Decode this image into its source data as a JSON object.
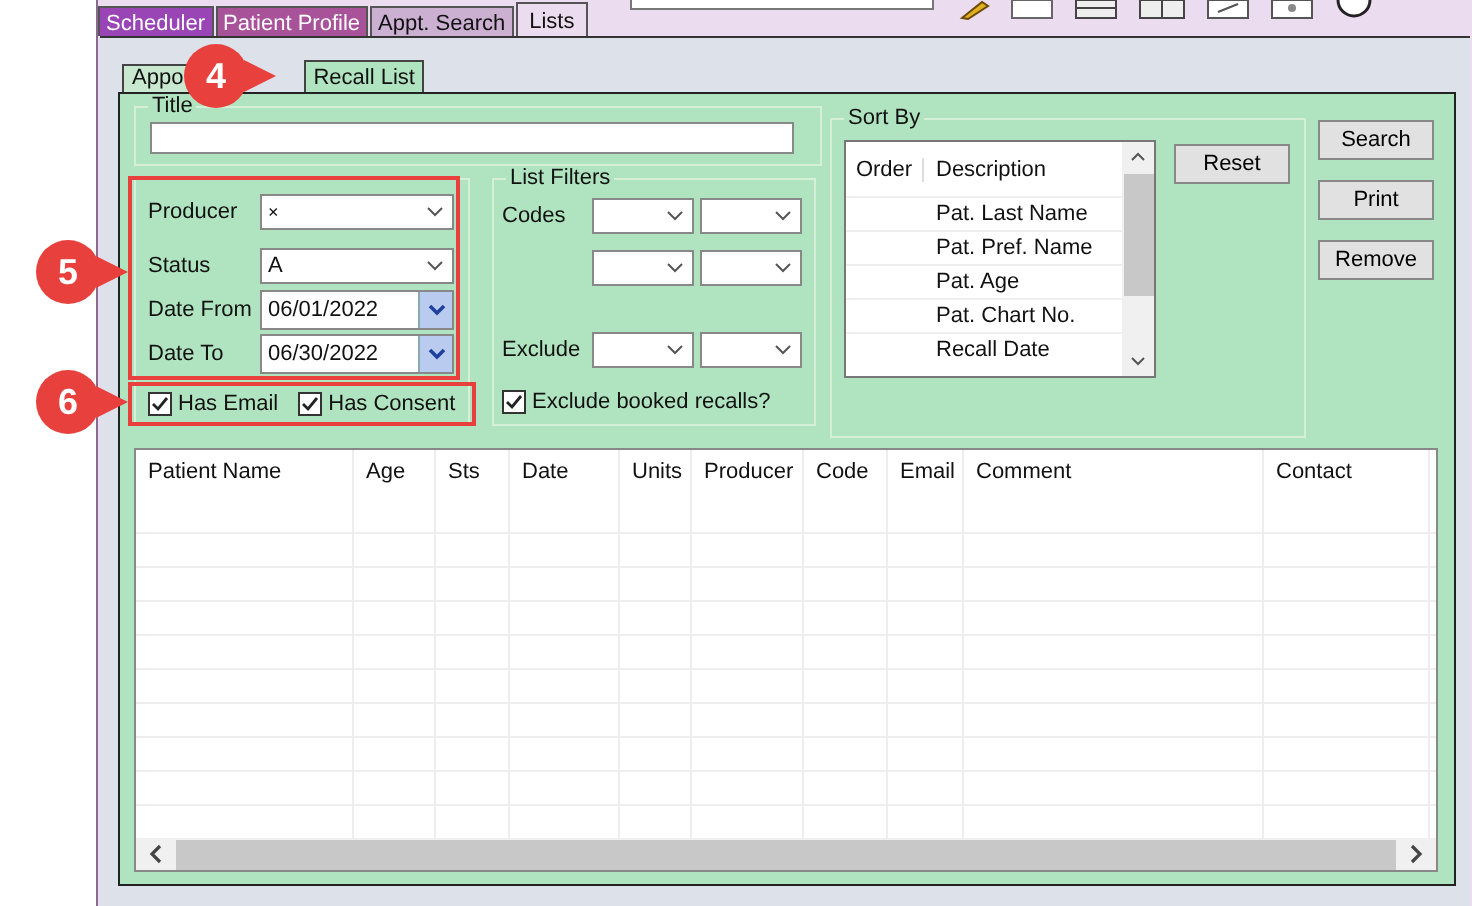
{
  "top_tabs": [
    {
      "label": "Scheduler",
      "selected": false,
      "color": "#9a45b6"
    },
    {
      "label": "Patient Profile",
      "selected": false,
      "color": "#a8529a"
    },
    {
      "label": "Appt. Search",
      "selected": false,
      "color": "#cbb0d2"
    },
    {
      "label": "Lists",
      "selected": true,
      "color": "#ecdcef"
    }
  ],
  "sub_tabs": [
    {
      "label": "Appo",
      "selected": false
    },
    {
      "label": "Recall List",
      "selected": true
    }
  ],
  "title_field": {
    "label": "Title"
  },
  "criteria": [
    {
      "label": "Producer",
      "kind": "select",
      "value": "×"
    },
    {
      "label": "Status",
      "kind": "select",
      "value": "A"
    },
    {
      "label": "Date From",
      "kind": "date",
      "value": "06/01/2022"
    },
    {
      "label": "Date To",
      "kind": "date",
      "value": "06/30/2022"
    }
  ],
  "checkboxes": [
    {
      "label": "Has Email",
      "checked": true
    },
    {
      "label": "Has Consent",
      "checked": true
    }
  ],
  "list_filters": {
    "title": "List Filters",
    "rows": [
      {
        "kind": "codes",
        "label": "Codes"
      },
      {
        "kind": "more"
      },
      {
        "kind": "exclude",
        "label": "Exclude"
      }
    ]
  },
  "exclude_booked": {
    "label": "Exclude booked recalls?",
    "checked": true
  },
  "sort_by": {
    "title": "Sort By",
    "columns": [
      "Order",
      "Description"
    ],
    "rows": [
      "Pat. Last Name",
      "Pat. Pref. Name",
      "Pat. Age",
      "Pat. Chart No.",
      "Recall Date"
    ]
  },
  "reset": "Reset",
  "actions": [
    "Search",
    "Print",
    "Remove"
  ],
  "grid": {
    "columns": [
      "Patient Name",
      "Age",
      "Sts",
      "Date",
      "Units",
      "Producer",
      "Code",
      "Email",
      "Comment",
      "Contact"
    ]
  },
  "callouts": [
    {
      "number": "4"
    },
    {
      "number": "5"
    },
    {
      "number": "6"
    }
  ]
}
